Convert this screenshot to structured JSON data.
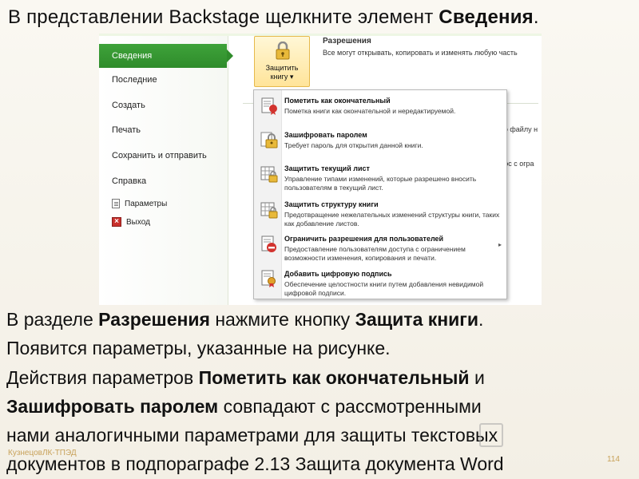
{
  "slide": {
    "title_part1": "В представлении Backstage щелкните элемент ",
    "title_bold": "Сведения",
    "title_end": "."
  },
  "backstage": {
    "nav": {
      "active": "Сведения",
      "items": [
        "Последние",
        "Создать",
        "Печать",
        "Сохранить и отправить",
        "Справка"
      ],
      "params": "Параметры",
      "exit": "Выход"
    },
    "protect_button": {
      "line1": "Защитить",
      "line2": "книгу ▾"
    },
    "permissions": {
      "title": "Разрешения",
      "desc": "Все могут открывать, копировать и изменять любую часть"
    },
    "right_snippets": [
      "по файлу н",
      "о",
      "дос с огра",
      "е"
    ],
    "menu": [
      {
        "title": "Пометить как окончательный",
        "desc": "Пометка книги как окончательной и нередактируемой.",
        "icon": "mark-final-icon"
      },
      {
        "title": "Зашифровать паролем",
        "desc": "Требует пароль для открытия данной книги.",
        "icon": "encrypt-lock-icon"
      },
      {
        "title": "Защитить текущий лист",
        "desc": "Управление типами изменений, которые разрешено вносить пользователям в текущий лист.",
        "icon": "protect-sheet-icon"
      },
      {
        "title": "Защитить структуру книги",
        "desc": "Предотвращение нежелательных изменений структуры книги, таких как добавление листов.",
        "icon": "protect-structure-icon"
      },
      {
        "title": "Ограничить разрешения для пользователей",
        "desc": "Предоставление пользователям доступа с ограничением возможности изменения, копирования и печати.",
        "icon": "restrict-permission-icon"
      },
      {
        "title": "Добавить цифровую подпись",
        "desc": "Обеспечение целостности книги путем добавления невидимой цифровой подписи.",
        "icon": "digital-signature-icon"
      }
    ]
  },
  "body": {
    "l1a": "В разделе ",
    "l1b": "Разрешения",
    "l1c": " нажмите кнопку ",
    "l1d": "Защита книги",
    "l1e": ".",
    "l2": "Появится параметры, указанные на рисунке.",
    "l3a": "Действия параметров ",
    "l3b": "Пометить как окончательный",
    "l3c": " и",
    "l4a": "Зашифровать паролем",
    "l4b": " совпадают с рассмотренными",
    "l5": "нами аналогичными параметрами для защиты текстовых",
    "l6": "документов в подпораграфе 2.13 Защита документа Word"
  },
  "footer": {
    "author": "КузнецовЛК-ТПЭД",
    "page": "114"
  }
}
